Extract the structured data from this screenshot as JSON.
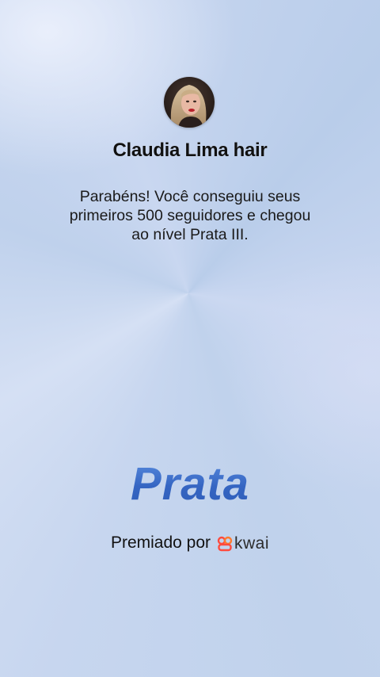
{
  "profile": {
    "name": "Claudia Lima hair"
  },
  "message": {
    "line1": "Parabéns! Você conseguiu seus",
    "line2": "primeiros 500 seguidores e chegou",
    "line3": "ao nível Prata III."
  },
  "level": {
    "title": "Prata"
  },
  "awarded": {
    "label": "Premiado por",
    "brand": "kwai"
  },
  "colors": {
    "level_title": "#3f6fc9",
    "brand_accent": "#ff4a3d",
    "background": "#c7d6ef"
  },
  "icons": {
    "brand": "kwai-logo-icon"
  }
}
